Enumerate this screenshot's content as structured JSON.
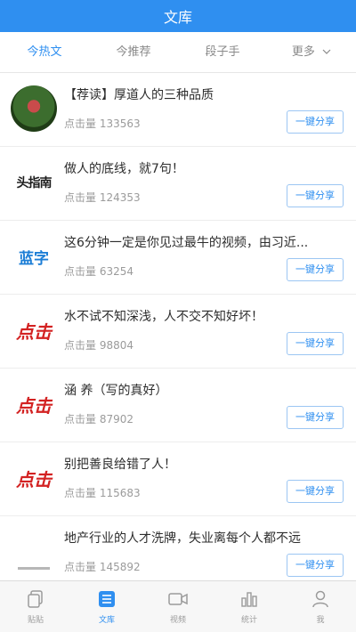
{
  "header": {
    "title": "文库"
  },
  "tabs": [
    {
      "label": "今热文",
      "active": true
    },
    {
      "label": "今推荐",
      "active": false
    },
    {
      "label": "段子手",
      "active": false
    },
    {
      "label": "更多",
      "active": false,
      "dropdown": true
    }
  ],
  "articles": [
    {
      "title": "【荐读】厚道人的三种品质",
      "views": "点击量 133563",
      "share": "一键分享",
      "thumb": "round-photo"
    },
    {
      "title": "做人的底线，就7句！",
      "views": "点击量 124353",
      "share": "一键分享",
      "thumb": "logo-text",
      "thumb_text": "头指南"
    },
    {
      "title": "这6分钟一定是你见过最牛的视频，由习近...",
      "views": "点击量 63254",
      "share": "一键分享",
      "thumb": "logo-blue",
      "thumb_text": "蓝字"
    },
    {
      "title": "水不试不知深浅，人不交不知好坏！",
      "views": "点击量 98804",
      "share": "一键分享",
      "thumb": "logo-red",
      "thumb_text": "点击"
    },
    {
      "title": "涵 养（写的真好）",
      "views": "点击量 87902",
      "share": "一键分享",
      "thumb": "logo-red",
      "thumb_text": "点击"
    },
    {
      "title": "别把善良给错了人！",
      "views": "点击量 115683",
      "share": "一键分享",
      "thumb": "logo-red",
      "thumb_text": "点击"
    },
    {
      "title": "地产行业的人才洗牌，失业离每个人都不远",
      "views": "点击量 145892",
      "share": "一键分享",
      "thumb": "line-gray"
    }
  ],
  "bottom_nav": [
    {
      "label": "贴贴",
      "icon": "copy-icon",
      "active": false
    },
    {
      "label": "文库",
      "icon": "document-icon",
      "active": true
    },
    {
      "label": "视频",
      "icon": "video-icon",
      "active": false
    },
    {
      "label": "统计",
      "icon": "chart-icon",
      "active": false
    },
    {
      "label": "我",
      "icon": "user-icon",
      "active": false
    }
  ],
  "colors": {
    "accent": "#2f8ff0",
    "text": "#2d2d2d",
    "muted": "#9b9b9b",
    "red_logo": "#d32222"
  }
}
